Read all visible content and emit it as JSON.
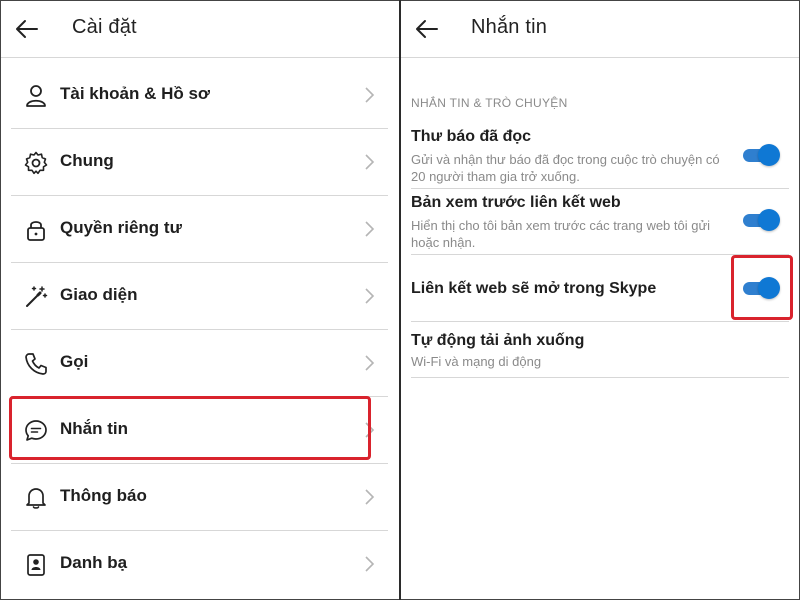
{
  "settings_panel": {
    "title": "Cài đặt",
    "items": [
      {
        "label": "Tài khoản & Hồ sơ",
        "icon": "user-icon"
      },
      {
        "label": "Chung",
        "icon": "gear-icon"
      },
      {
        "label": "Quyền riêng tư",
        "icon": "lock-icon"
      },
      {
        "label": "Giao diện",
        "icon": "magic-wand-icon"
      },
      {
        "label": "Gọi",
        "icon": "phone-icon"
      },
      {
        "label": "Nhắn tin",
        "icon": "chat-bubble-icon"
      },
      {
        "label": "Thông báo",
        "icon": "bell-icon"
      },
      {
        "label": "Danh bạ",
        "icon": "contacts-book-icon"
      }
    ],
    "highlighted_item": "Nhắn tin"
  },
  "messaging_panel": {
    "title": "Nhắn tin",
    "section_header": "NHẮN TIN & TRÒ CHUYỆN",
    "settings": [
      {
        "title": "Thư báo đã đọc",
        "description": "Gửi và nhận thư báo đã đọc trong cuộc trò chuyện có 20 người tham gia trở xuống.",
        "toggle": true
      },
      {
        "title": "Bản xem trước liên kết web",
        "description": "Hiển thị cho tôi bản xem trước các trang web tôi gửi hoặc nhận.",
        "toggle": true
      },
      {
        "title": "Liên kết web sẽ mở trong Skype",
        "description": "",
        "toggle": true
      },
      {
        "title": "Tự động tải ảnh xuống",
        "description": "Wi-Fi và mạng di động",
        "toggle": null
      }
    ]
  },
  "colors": {
    "accent": "#0f78d4",
    "highlight": "#d9232d",
    "text": "#1f1f1f",
    "muted": "#8a8a8a",
    "divider": "#d7d7d7"
  }
}
